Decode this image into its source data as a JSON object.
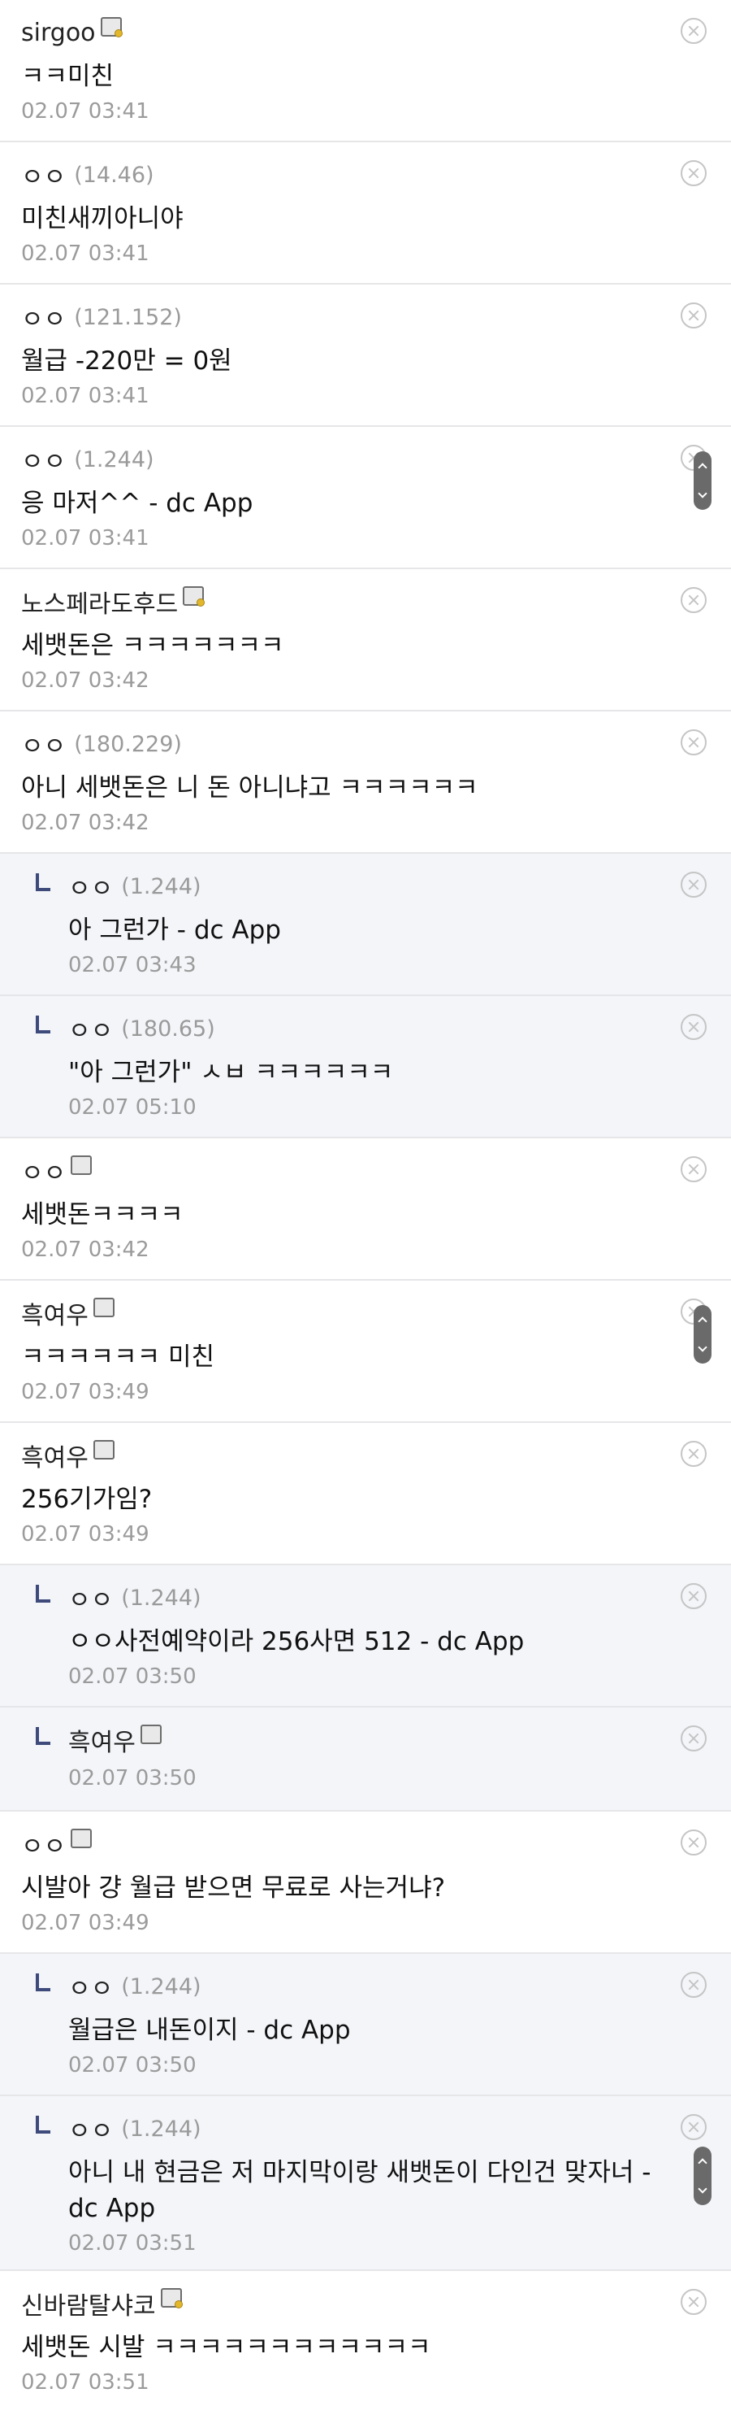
{
  "comments": [
    {
      "name": "sirgoo",
      "ip": "",
      "badge": "gallog",
      "text": "ㅋㅋ미친",
      "date": "02.07 03:41",
      "reply": false
    },
    {
      "name": "ㅇㅇ",
      "ip": "(14.46)",
      "badge": "",
      "text": "미친새끼아니야",
      "date": "02.07 03:41",
      "reply": false
    },
    {
      "name": "ㅇㅇ",
      "ip": "(121.152)",
      "badge": "",
      "text": "월급 -220만 = 0원",
      "date": "02.07 03:41",
      "reply": false
    },
    {
      "name": "ㅇㅇ",
      "ip": "(1.244)",
      "badge": "",
      "text": "응 마저^^ - dc App",
      "date": "02.07 03:41",
      "reply": false,
      "scroll": true
    },
    {
      "name": "노스페라도후드",
      "ip": "",
      "badge": "gallog",
      "text": "세뱃돈은 ㅋㅋㅋㅋㅋㅋㅋ",
      "date": "02.07 03:42",
      "reply": false
    },
    {
      "name": "ㅇㅇ",
      "ip": "(180.229)",
      "badge": "",
      "text": "아니 세뱃돈은 니 돈 아니냐고 ㅋㅋㅋㅋㅋㅋ",
      "date": "02.07 03:42",
      "reply": false
    },
    {
      "name": "ㅇㅇ",
      "ip": "(1.244)",
      "badge": "",
      "text": "아 그런가 - dc App",
      "date": "02.07 03:43",
      "reply": true
    },
    {
      "name": "ㅇㅇ",
      "ip": "(180.65)",
      "badge": "",
      "text": "\"아 그런가\" ㅅㅂ ㅋㅋㅋㅋㅋㅋ",
      "date": "02.07 05:10",
      "reply": true
    },
    {
      "name": "ㅇㅇ",
      "ip": "",
      "badge": "fixed",
      "text": "세뱃돈ㅋㅋㅋㅋ",
      "date": "02.07 03:42",
      "reply": false
    },
    {
      "name": "흑여우",
      "ip": "",
      "badge": "fixed",
      "text": "ㅋㅋㅋㅋㅋㅋ 미친",
      "date": "02.07 03:49",
      "reply": false,
      "scroll": true
    },
    {
      "name": "흑여우",
      "ip": "",
      "badge": "fixed",
      "text": "256기가임?",
      "date": "02.07 03:49",
      "reply": false
    },
    {
      "name": "ㅇㅇ",
      "ip": "(1.244)",
      "badge": "",
      "text": "ㅇㅇ사전예약이라 256사면 512 - dc App",
      "date": "02.07 03:50",
      "reply": true
    },
    {
      "name": "흑여우",
      "ip": "",
      "badge": "fixed",
      "text": "",
      "date": "02.07 03:50",
      "reply": true
    },
    {
      "name": "ㅇㅇ",
      "ip": "",
      "badge": "fixed",
      "text": "시발아 걍 월급 받으면 무료로 사는거냐?",
      "date": "02.07 03:49",
      "reply": false
    },
    {
      "name": "ㅇㅇ",
      "ip": "(1.244)",
      "badge": "",
      "text": "월급은 내돈이지 - dc App",
      "date": "02.07 03:50",
      "reply": true
    },
    {
      "name": "ㅇㅇ",
      "ip": "(1.244)",
      "badge": "",
      "text": "아니 내 현금은 저 마지막이랑 새뱃돈이 다인건 맞자너 - dc App",
      "date": "02.07 03:51",
      "reply": true,
      "scroll": true,
      "tall": true
    },
    {
      "name": "신바람탈샤코",
      "ip": "",
      "badge": "gallog",
      "text": "세뱃돈 시발 ㅋㅋㅋㅋㅋㅋㅋㅋㅋㅋㅋㅋ",
      "date": "02.07 03:51",
      "reply": false,
      "last": true
    }
  ]
}
